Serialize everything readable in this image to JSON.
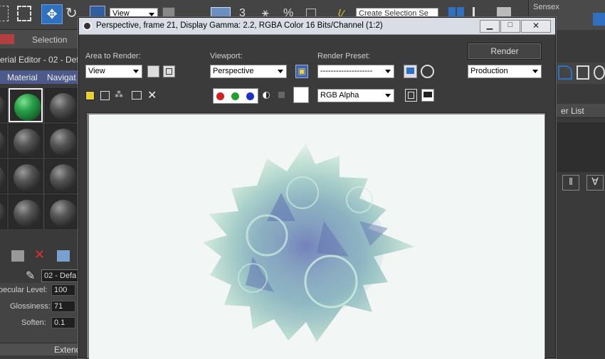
{
  "top_toolbar": {
    "view_dropdown": "View",
    "number_label": "3",
    "percent_label": "%",
    "selection_set_placeholder": "Create Selection Se",
    "sensex_label": "Sensex"
  },
  "left_panel": {
    "tab_selection": "Selection",
    "material_editor_title": "erial Editor - 02 - Def",
    "menu_material": "Material",
    "menu_navigation": "Navigat",
    "material_name": "02 - Defa",
    "specular_level_label": "pecular Level:",
    "specular_level_value": "100",
    "glossiness_label": "Glossiness:",
    "glossiness_value": "71",
    "soften_label": "Soften:",
    "soften_value": "0.1",
    "extended_label": "Extend"
  },
  "right_panel": {
    "modifier_list_label": "er List"
  },
  "render_window": {
    "title": "Perspective, frame 21, Display Gamma: 2.2, RGBA Color 16 Bits/Channel (1:2)",
    "area_to_render_label": "Area to Render:",
    "area_to_render_value": "View",
    "viewport_label": "Viewport:",
    "viewport_value": "Perspective",
    "render_preset_label": "Render Preset:",
    "render_preset_value": "--------------------",
    "render_button": "Render",
    "production_value": "Production",
    "channel_value": "RGB Alpha"
  },
  "colors": {
    "red_channel": "#d42020",
    "green_channel": "#20a030",
    "blue_channel": "#2030c8",
    "accent_blue": "#3070c0"
  }
}
